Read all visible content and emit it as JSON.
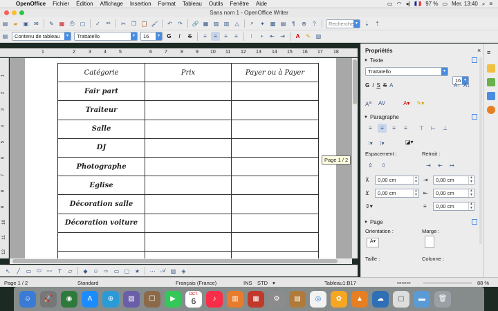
{
  "menubar": {
    "app": "OpenOffice",
    "items": [
      "Fichier",
      "Édition",
      "Affichage",
      "Insertion",
      "Format",
      "Tableau",
      "Outils",
      "Fenêtre",
      "Aide"
    ],
    "battery": "97 %",
    "flag": "🇫🇷",
    "clock": "Mer. 13:40"
  },
  "window": {
    "title": "Sans nom 1 - OpenOffice Writer"
  },
  "toolbar": {
    "search_placeholder": "Rechercher",
    "style_value": "Contenu de tableau",
    "font_value": "Trattatello",
    "size_value": "16",
    "bold": "G",
    "italic": "I",
    "strike": "S"
  },
  "ruler": {
    "marks": [
      "1",
      "1",
      "2",
      "3",
      "4",
      "5",
      "6",
      "7",
      "8",
      "9",
      "10",
      "11",
      "12",
      "13",
      "14",
      "15",
      "16",
      "17",
      "18"
    ],
    "vmarks": [
      "1",
      "2",
      "3",
      "4",
      "5",
      "6",
      "7",
      "8",
      "9",
      "10",
      "11",
      "12"
    ]
  },
  "table": {
    "headers": [
      "Catégorie",
      "Prix",
      "Payer ou à Payer"
    ],
    "rows": [
      "Fair part",
      "Traiteur",
      "Salle",
      "DJ",
      "Photographe",
      "Eglise",
      "Décoration salle",
      "Décoration voiture",
      ""
    ]
  },
  "tooltip": "Page 1 / 2",
  "sidebar": {
    "title": "Propriétés",
    "text_section": "Texte",
    "font": "Trattatello",
    "size": "16",
    "para_section": "Paragraphe",
    "spacing_label": "Espacement :",
    "indent_label": "Retrait :",
    "values": [
      "0,00 cm",
      "0,00 cm",
      "0,00 cm",
      "0,00 cm",
      "0,00 cm"
    ],
    "page_section": "Page",
    "orientation_label": "Orientation :",
    "margin_label": "Marge :",
    "size_label": "Taille :",
    "column_label": "Colonne :"
  },
  "status": {
    "page": "Page 1 / 2",
    "style": "Standard",
    "lang": "Français (France)",
    "ins": "INS",
    "std": "STD",
    "cell": "Tableau1:B17",
    "zoom": "88 %"
  },
  "dock": {
    "calendar_month": "OCT.",
    "calendar_day": "6"
  }
}
